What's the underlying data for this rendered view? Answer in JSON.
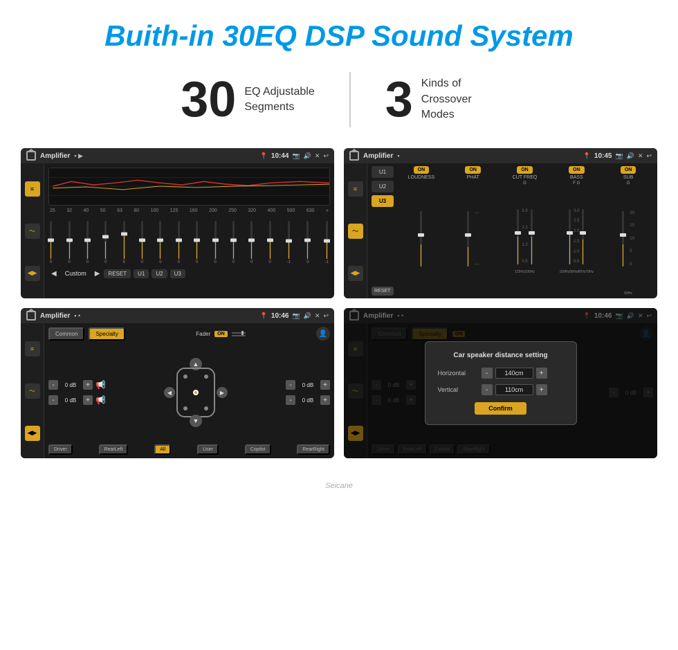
{
  "page": {
    "title": "Buith-in 30EQ DSP Sound System"
  },
  "stats": {
    "eq": {
      "number": "30",
      "desc_line1": "EQ Adjustable",
      "desc_line2": "Segments"
    },
    "crossover": {
      "number": "3",
      "desc_line1": "Kinds of",
      "desc_line2": "Crossover Modes"
    }
  },
  "screen1": {
    "app_name": "Amplifier",
    "time": "10:44",
    "eq_labels": [
      "25",
      "32",
      "40",
      "50",
      "63",
      "80",
      "100",
      "125",
      "160",
      "200",
      "250",
      "320",
      "400",
      "500",
      "630"
    ],
    "eq_values": [
      "0",
      "0",
      "0",
      "0",
      "5",
      "0",
      "0",
      "0",
      "0",
      "0",
      "0",
      "0",
      "0",
      "-1",
      "0",
      "-1"
    ],
    "bottom_buttons": [
      "RESET",
      "U1",
      "U2",
      "U3"
    ],
    "preset_label": "Custom"
  },
  "screen2": {
    "app_name": "Amplifier",
    "time": "10:45",
    "presets": [
      "U1",
      "U2",
      "U3"
    ],
    "active_preset": "U3",
    "channels": [
      {
        "toggle": "ON",
        "name": "LOUDNESS",
        "letter": ""
      },
      {
        "toggle": "ON",
        "name": "PHAT",
        "letter": ""
      },
      {
        "toggle": "ON",
        "name": "CUT FREQ",
        "letter": "G"
      },
      {
        "toggle": "ON",
        "name": "BASS",
        "letter": "F G"
      },
      {
        "toggle": "ON",
        "name": "SUB",
        "letter": "G"
      }
    ],
    "reset_label": "RESET"
  },
  "screen3": {
    "app_name": "Amplifier",
    "time": "10:46",
    "tabs": [
      "Common",
      "Specialty"
    ],
    "active_tab": "Specialty",
    "fader_label": "Fader",
    "fader_on": "ON",
    "gains": [
      "0 dB",
      "0 dB",
      "0 dB",
      "0 dB"
    ],
    "speaker_btns": [
      "Driver",
      "RearLeft",
      "All",
      "User",
      "Copilot",
      "RearRight"
    ]
  },
  "screen4": {
    "app_name": "Amplifier",
    "time": "10:46",
    "tabs": [
      "Common",
      "Specialty"
    ],
    "active_tab": "Specialty",
    "fader_on": "ON",
    "gains": [
      "0 dB",
      "0 dB"
    ],
    "speaker_btns_left": [
      "Driver",
      "RearLeft"
    ],
    "speaker_btns_right": [
      "Copilot",
      "RearRight"
    ],
    "dialog": {
      "title": "Car speaker distance setting",
      "horizontal_label": "Horizontal",
      "horizontal_value": "140cm",
      "vertical_label": "Vertical",
      "vertical_value": "110cm",
      "confirm_label": "Confirm"
    }
  },
  "watermark": "Seicane"
}
